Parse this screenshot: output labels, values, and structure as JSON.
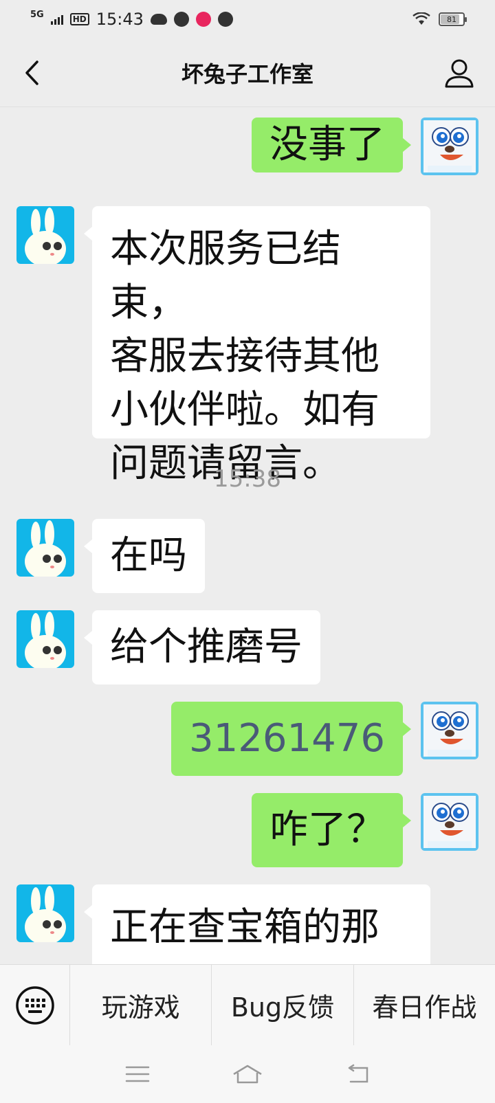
{
  "status_bar": {
    "network": "5G",
    "hd": "HD",
    "time": "15:43",
    "battery": "81",
    "icons": [
      "cloud-icon",
      "music-icon",
      "app-icon",
      "compass-icon",
      "wifi-icon",
      "battery-icon"
    ]
  },
  "header": {
    "title": "坏兔子工作室",
    "back_icon": "chevron-left-icon",
    "profile_icon": "user-icon"
  },
  "messages": [
    {
      "from": "me",
      "text": "没事了"
    },
    {
      "from": "bot",
      "lines": [
        "本次服务已结束，",
        "客服去接待其他",
        "小伙伴啦。如有",
        "问题请留言。"
      ]
    },
    {
      "timestamp": "15:38"
    },
    {
      "from": "bot",
      "text": "在吗"
    },
    {
      "from": "bot",
      "text": "给个推磨号"
    },
    {
      "from": "me",
      "text": "31261476"
    },
    {
      "from": "me",
      "text": "咋了？"
    },
    {
      "from": "bot",
      "text": "正在查宝箱的那"
    }
  ],
  "menu": {
    "keyboard_icon": "keyboard-icon",
    "items": [
      "玩游戏",
      "Bug反馈",
      "春日作战"
    ]
  },
  "navbar": {
    "icons": [
      "menu-icon",
      "home-icon",
      "back-icon"
    ]
  },
  "colors": {
    "background": "#ededed",
    "outgoing_bubble": "#95ec69",
    "incoming_bubble": "#ffffff",
    "bot_avatar_bg": "#12b6e8"
  }
}
